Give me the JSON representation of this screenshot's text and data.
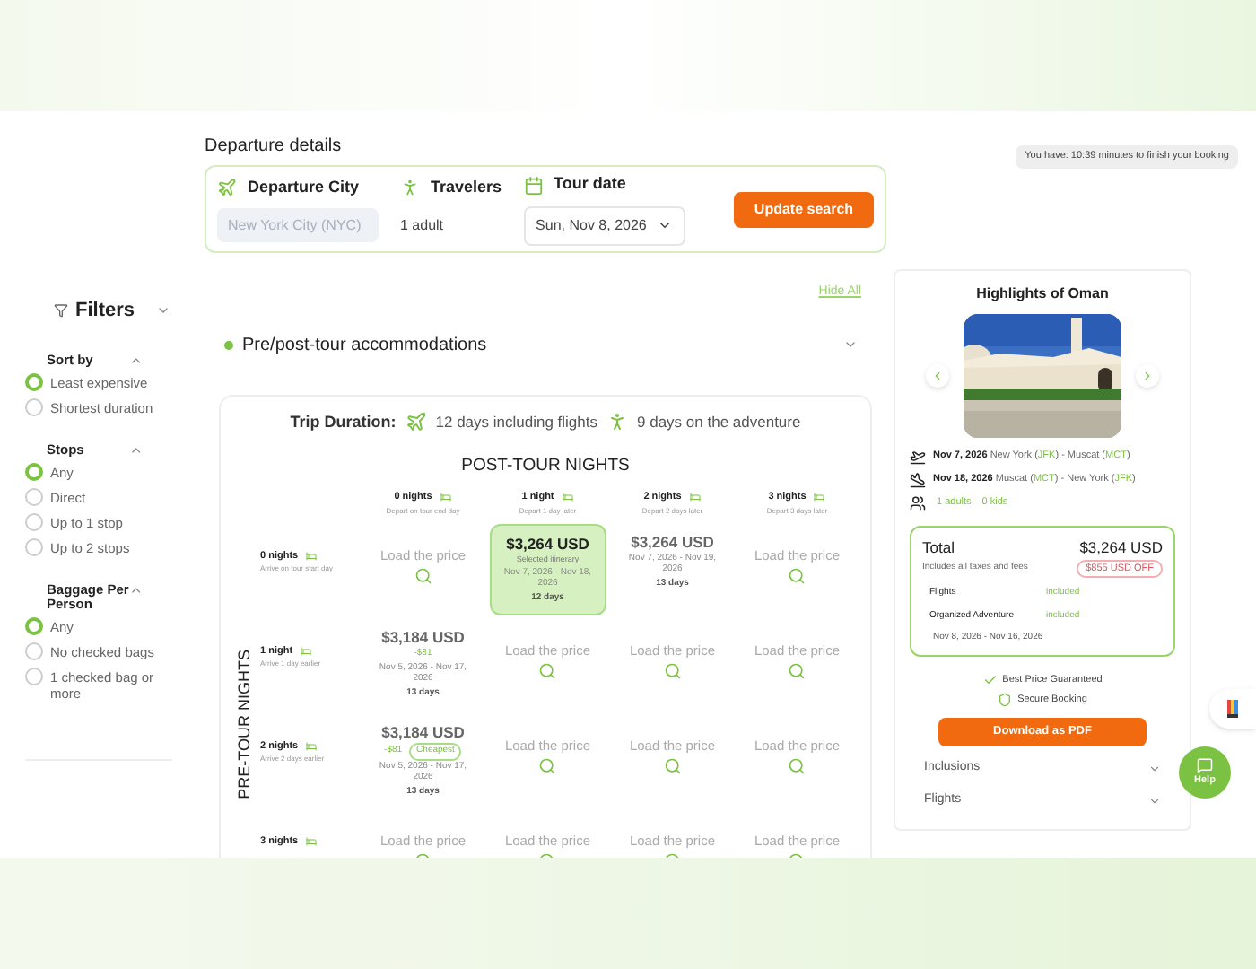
{
  "timer": "You have: 10:39 minutes to finish your booking",
  "departure": {
    "title": "Departure details",
    "fields": [
      {
        "kind": "input",
        "label": "Departure City",
        "placeholder": "New York City (NYC)"
      },
      {
        "kind": "text",
        "label": "Travelers",
        "value": "1 adult"
      },
      {
        "kind": "select",
        "label": "Tour date",
        "value": "Sun, Nov 8, 2026"
      }
    ],
    "button": "Update search"
  },
  "filters": {
    "title": "Filters",
    "groups": [
      {
        "title": "Sort by",
        "expanded": true,
        "options": [
          {
            "label": "Least expensive",
            "selected": true
          },
          {
            "label": "Shortest duration",
            "selected": false
          }
        ]
      },
      {
        "title": "Stops",
        "expanded": true,
        "options": [
          {
            "label": "Any",
            "selected": true
          },
          {
            "label": "Direct",
            "selected": false
          },
          {
            "label": "Up to 1 stop",
            "selected": false
          },
          {
            "label": "Up to 2 stops",
            "selected": false
          }
        ]
      },
      {
        "title": "Baggage Per Person",
        "expanded": true,
        "options": [
          {
            "label": "Any",
            "selected": true
          },
          {
            "label": "No checked bags",
            "selected": false
          },
          {
            "label": "1 checked bag or more",
            "selected": false
          }
        ]
      }
    ]
  },
  "hide_all": "Hide All",
  "section": {
    "title": "Pre/post-tour accommodations"
  },
  "trip": {
    "label": "Trip Duration:",
    "flights": "12 days including flights",
    "adventure": "9 days on the adventure"
  },
  "matrix": {
    "column_title": "POST-TOUR NIGHTS",
    "row_title": "PRE-TOUR NIGHTS",
    "columns": [
      {
        "label": "0 nights",
        "sub": "Depart on tour end day"
      },
      {
        "label": "1 night",
        "sub": "Depart 1 day later"
      },
      {
        "label": "2 nights",
        "sub": "Depart 2 days later"
      },
      {
        "label": "3 nights",
        "sub": "Depart 3 days later"
      }
    ],
    "rows": [
      {
        "label": "0 nights",
        "sub": "Arrive on tour start day",
        "cells": [
          {
            "kind": "load",
            "text": "Load the price",
            "selected": false
          },
          {
            "kind": "price",
            "price": "$3,264 USD",
            "note": "Selected itinerary",
            "dates": "Nov 7, 2026 - Nov 18, 2026",
            "days": "12 days",
            "selected": true
          },
          {
            "kind": "price",
            "price": "$3,264 USD",
            "dates": "Nov 7, 2026 - Nov 19, 2026",
            "days": "13 days",
            "selected": false
          },
          {
            "kind": "load",
            "text": "Load the price",
            "selected": false
          }
        ]
      },
      {
        "label": "1 night",
        "sub": "Arrive 1 day earlier",
        "cells": [
          {
            "kind": "price",
            "price": "$3,184 USD",
            "diff": "-$81",
            "dates": "Nov 5, 2026 - Nov 17, 2026",
            "days": "13 days",
            "selected": false
          },
          {
            "kind": "load",
            "text": "Load the price",
            "selected": false
          },
          {
            "kind": "load",
            "text": "Load the price",
            "selected": false
          },
          {
            "kind": "load",
            "text": "Load the price",
            "selected": false
          }
        ]
      },
      {
        "label": "2 nights",
        "sub": "Arrive 2 days earlier",
        "cells": [
          {
            "kind": "price",
            "price": "$3,184 USD",
            "diff": "-$81",
            "badge": "Cheapest",
            "dates": "Nov 5, 2026 - Nov 17, 2026",
            "days": "13 days",
            "selected": false
          },
          {
            "kind": "load",
            "text": "Load the price",
            "selected": false
          },
          {
            "kind": "load",
            "text": "Load the price",
            "selected": false
          },
          {
            "kind": "load",
            "text": "Load the price",
            "selected": false
          }
        ]
      },
      {
        "label": "3 nights",
        "cells": [
          {
            "kind": "load",
            "text": "Load the price",
            "selected": false
          },
          {
            "kind": "load",
            "text": "Load the price",
            "selected": false
          },
          {
            "kind": "load",
            "text": "Load the price",
            "selected": false
          },
          {
            "kind": "load",
            "text": "Load the price",
            "selected": false
          }
        ]
      }
    ]
  },
  "summary": {
    "title": "Highlights of Oman",
    "flights": [
      {
        "kind": "outbound",
        "date": "Nov 7, 2026",
        "segments": [
          {
            "text": "New York (",
            "highlight": false
          },
          {
            "text": "JFK",
            "highlight": true
          },
          {
            "text": ") - Muscat (",
            "highlight": false
          },
          {
            "text": "MCT",
            "highlight": true
          },
          {
            "text": ")",
            "highlight": false
          }
        ]
      },
      {
        "kind": "return",
        "date": "Nov 18, 2026",
        "segments": [
          {
            "text": "Muscat (",
            "highlight": false
          },
          {
            "text": "MCT",
            "highlight": true
          },
          {
            "text": ") - New York (",
            "highlight": false
          },
          {
            "text": "JFK",
            "highlight": true
          },
          {
            "text": ")",
            "highlight": false
          }
        ]
      }
    ],
    "travelers": [
      "1 adults",
      "0 kids"
    ],
    "total": {
      "label": "Total",
      "price": "$3,264 USD",
      "note": "Includes all taxes and fees",
      "discount": "$855 USD OFF",
      "items": [
        {
          "name": "Flights",
          "status": "included"
        },
        {
          "name": "Organized Adventure",
          "status": "included"
        }
      ],
      "dates": "Nov 8, 2026 - Nov 16, 2026"
    },
    "guarantees": [
      {
        "kind": "check",
        "text": "Best Price Guaranteed"
      },
      {
        "kind": "shield",
        "text": "Secure Booking"
      }
    ],
    "download": "Download as PDF",
    "accordions": [
      {
        "label": "Inclusions"
      },
      {
        "label": "Flights"
      }
    ]
  },
  "help": "Help"
}
